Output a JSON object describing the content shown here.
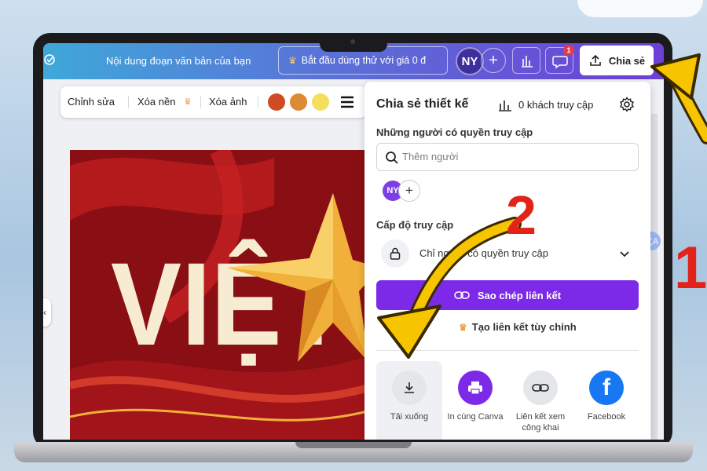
{
  "topbar": {
    "doc_title": "Nội dung đoạn văn bản của bạn",
    "trial_label": "Bắt đầu dùng thử với giá 0 đ",
    "avatar_initials": "NY",
    "notification_count": "1",
    "share_label": "Chia sẻ",
    "gradient": [
      "#3fa8d8",
      "#6d3fd6"
    ]
  },
  "toolbar": {
    "edit_label": "Chỉnh sửa",
    "remove_bg_label": "Xóa nền",
    "erase_label": "Xóa ảnh",
    "swatches": [
      "#cf4b22",
      "#dc8a34",
      "#f3df5c"
    ]
  },
  "canvas": {
    "artwork_text": "VIỆT",
    "text_color": "#f7ecd2",
    "bg_color": "#8a0f14",
    "star_color": "#f0b03a"
  },
  "share_panel": {
    "title": "Chia sẻ thiết kế",
    "visitor_label": "0 khách truy cập",
    "access_heading": "Những người có quyền truy cập",
    "add_people_placeholder": "Thêm người",
    "member_initials": "NY",
    "level_heading": "Cấp độ truy cập",
    "access_value": "Chỉ người có quyền truy cập",
    "copy_link_label": "Sao chép liên kết",
    "custom_link_label": "Tạo liên kết tùy chỉnh",
    "options": [
      {
        "label": "Tải xuống",
        "icon": "download-icon"
      },
      {
        "label": "In cùng Canva",
        "icon": "printer-icon"
      },
      {
        "label": "Liên kết xem công khai",
        "icon": "link-icon"
      },
      {
        "label": "Facebook",
        "icon": "facebook-icon"
      }
    ],
    "accent": "#7d2ae8"
  },
  "annotations": {
    "step1": "1",
    "step2": "2",
    "color": "#e2231a",
    "arrow_color": "#f7c400"
  }
}
